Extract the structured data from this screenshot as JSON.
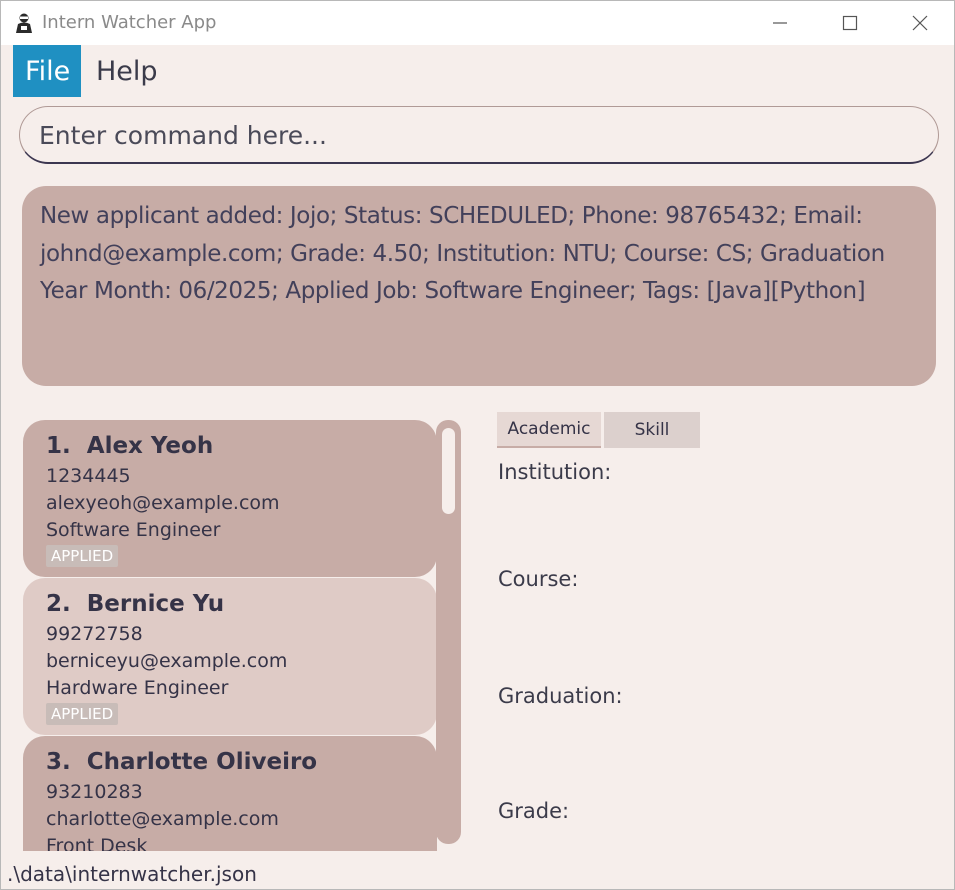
{
  "window": {
    "title": "Intern Watcher App"
  },
  "menu": {
    "file": "File",
    "help": "Help"
  },
  "command": {
    "placeholder": "Enter command here..."
  },
  "result": {
    "text": "New applicant added: Jojo; Status: SCHEDULED; Phone: 98765432; Email: johnd@example.com; Grade: 4.50; Institution: NTU; Course: CS; Graduation Year Month: 06/2025; Applied Job: Software Engineer; Tags: [Java][Python]"
  },
  "applicants": [
    {
      "index": "1.",
      "name": "Alex Yeoh",
      "phone": "1234445",
      "email": "alexyeoh@example.com",
      "job": "Software Engineer",
      "status": "APPLIED"
    },
    {
      "index": "2.",
      "name": "Bernice Yu",
      "phone": "99272758",
      "email": "berniceyu@example.com",
      "job": "Hardware Engineer",
      "status": "APPLIED"
    },
    {
      "index": "3.",
      "name": "Charlotte Oliveiro",
      "phone": "93210283",
      "email": "charlotte@example.com",
      "job": "Front Desk",
      "status": ""
    }
  ],
  "detail": {
    "tabs": [
      "Academic",
      "Skill"
    ],
    "active_tab": "Academic",
    "fields": [
      "Institution:",
      "Course:",
      "Graduation:",
      "Grade:"
    ]
  },
  "status_bar": {
    "path": ".\\data\\internwatcher.json"
  },
  "colors": {
    "accent": "#1f90c2",
    "card_dark": "#c7aca6",
    "card_light": "#dfcbc6",
    "background": "#f6eeeb",
    "text": "#353347"
  }
}
